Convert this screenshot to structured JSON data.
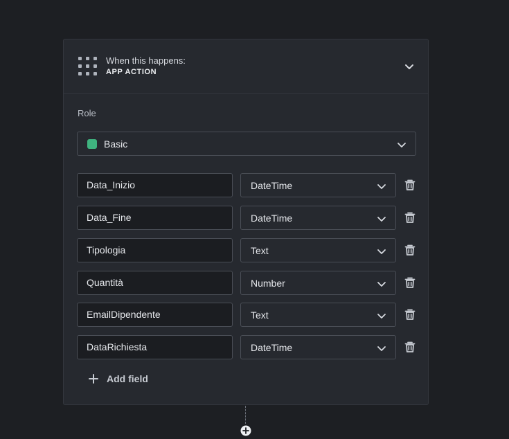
{
  "trigger": {
    "subtitle": "When this happens:",
    "title": "APP ACTION",
    "icon": "grid-dots-icon"
  },
  "role": {
    "label": "Role",
    "selected": "Basic",
    "swatch_color": "#3fb37f"
  },
  "fields": [
    {
      "name": "Data_Inizio",
      "type": "DateTime"
    },
    {
      "name": "Data_Fine",
      "type": "DateTime"
    },
    {
      "name": "Tipologia",
      "type": "Text"
    },
    {
      "name": "Quantità",
      "type": "Number"
    },
    {
      "name": "EmailDipendente",
      "type": "Text"
    },
    {
      "name": "DataRichiesta",
      "type": "DateTime"
    }
  ],
  "add_field_label": "Add field",
  "colors": {
    "background": "#1d1f23",
    "card": "#26292f",
    "border": "#4a4e56",
    "text": "#e6e8ec"
  }
}
